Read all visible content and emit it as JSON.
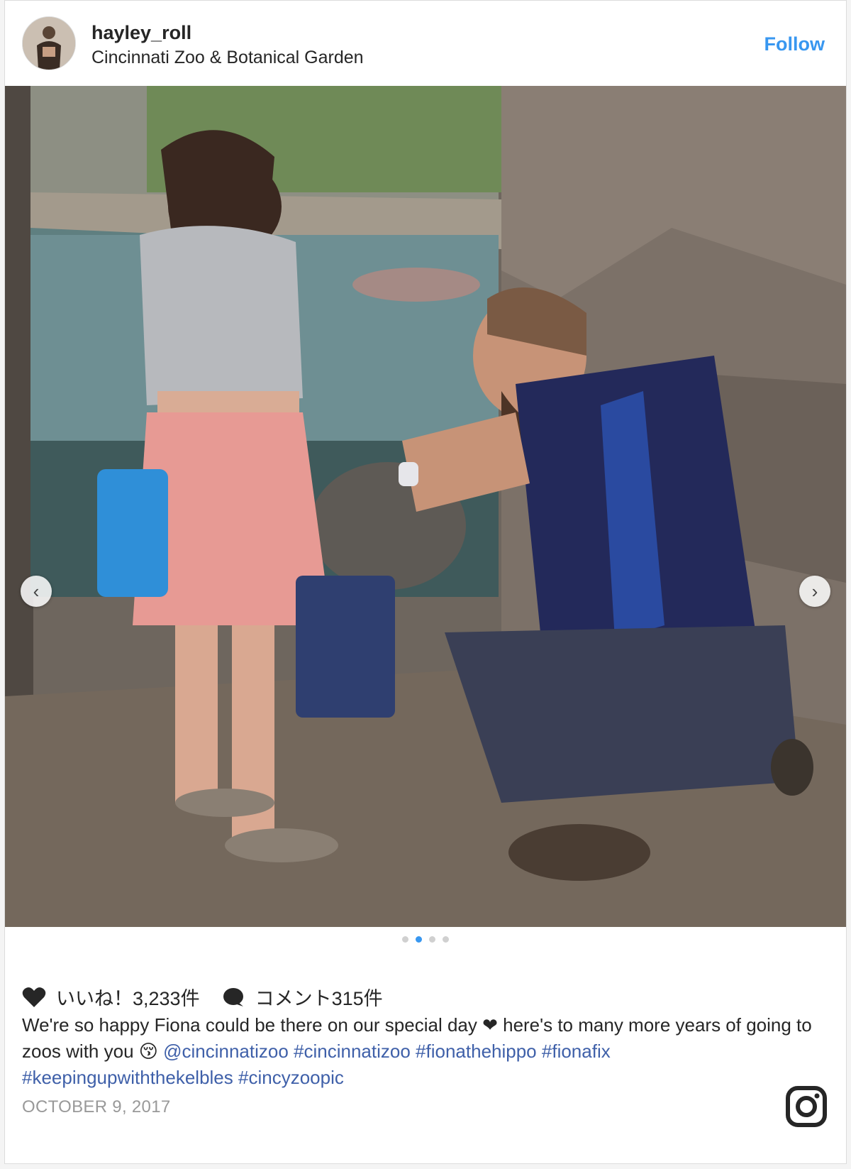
{
  "post": {
    "username": "hayley_roll",
    "location": "Cincinnati Zoo & Botanical Garden",
    "follow_label": "Follow",
    "carousel": {
      "total": 4,
      "active_index": 1
    },
    "likes_label": "いいね！3,233件",
    "comments_label": "コメント315件",
    "caption": {
      "text_1": "We're so happy Fiona could be there on our special day ❤ here's to many more years of going to zoos with you 😚 ",
      "mention": "@cincinnatizoo",
      "tags": [
        "#cincinnatizoo",
        "#fionathehippo",
        "#fionafix",
        "#keepingupwiththekelbles",
        "#cincyzoopic"
      ]
    },
    "date": "OCTOBER 9, 2017"
  },
  "icons": {
    "avatar": "avatar",
    "prev": "chevron-left-icon",
    "next": "chevron-right-icon",
    "like": "heart-icon",
    "comment": "comment-bubble-icon",
    "brand": "instagram-icon"
  },
  "colors": {
    "accent": "#3897f0",
    "hashtag": "#3f60a9",
    "date": "#999999"
  }
}
